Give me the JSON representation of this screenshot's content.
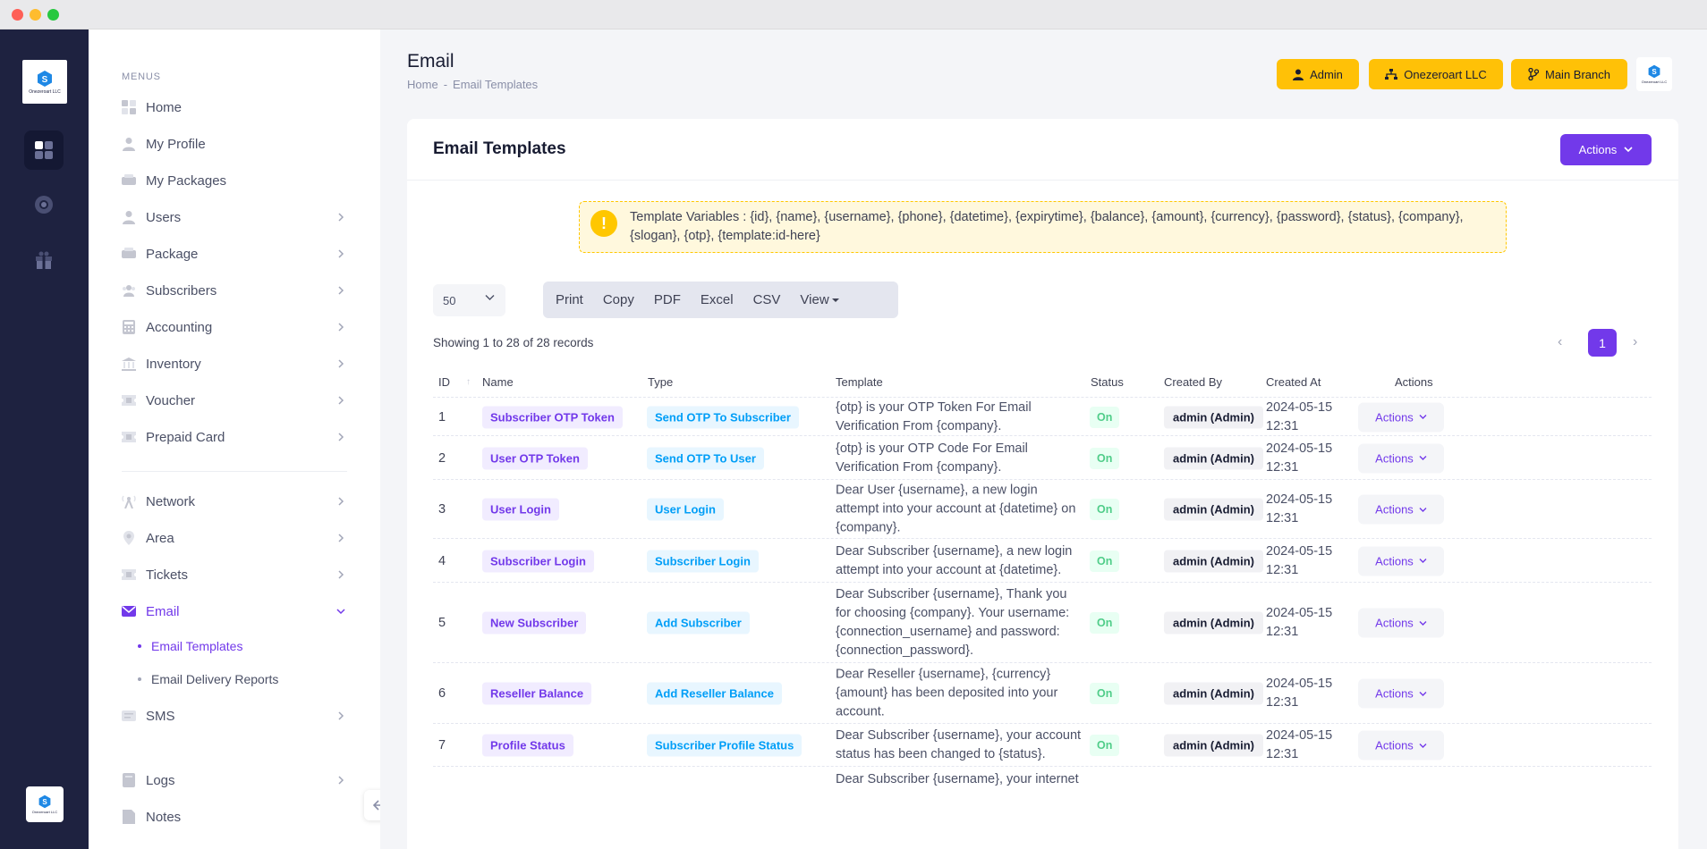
{
  "rail": {
    "logo_caption": "Onezeroart LLC",
    "bottom_logo_caption": "Onezeroart LLC"
  },
  "sidebar": {
    "menus_label": "MENUS",
    "items": [
      {
        "label": "Home",
        "icon": "home-grid-icon"
      },
      {
        "label": "My Profile",
        "icon": "user-icon"
      },
      {
        "label": "My Packages",
        "icon": "packages-icon"
      },
      {
        "label": "Users",
        "icon": "user-icon"
      },
      {
        "label": "Package",
        "icon": "packages-icon"
      },
      {
        "label": "Subscribers",
        "icon": "users-group-icon"
      },
      {
        "label": "Accounting",
        "icon": "calculator-icon"
      },
      {
        "label": "Inventory",
        "icon": "bank-icon"
      },
      {
        "label": "Voucher",
        "icon": "ticket-icon"
      },
      {
        "label": "Prepaid Card",
        "icon": "ticket-icon"
      },
      {
        "label": "Network",
        "icon": "antenna-icon"
      },
      {
        "label": "Area",
        "icon": "map-pin-icon"
      },
      {
        "label": "Tickets",
        "icon": "ticket-icon"
      },
      {
        "label": "Email",
        "icon": "envelope-icon"
      },
      {
        "label": "SMS",
        "icon": "message-icon"
      },
      {
        "label": "Logs",
        "icon": "book-icon"
      },
      {
        "label": "Notes",
        "icon": "note-icon"
      }
    ],
    "email_sub": [
      {
        "label": "Email Templates"
      },
      {
        "label": "Email Delivery Reports"
      }
    ]
  },
  "header": {
    "title": "Email",
    "breadcrumb": [
      "Home",
      "-",
      "Email Templates"
    ],
    "buttons": {
      "admin": "Admin",
      "company": "Onezeroart LLC",
      "branch": "Main Branch"
    },
    "logo_caption": "Onezeroart LLC"
  },
  "card": {
    "title": "Email Templates",
    "actions_label": "Actions",
    "alert_text": "Template Variables : {id}, {name}, {username}, {phone}, {datetime}, {expirytime}, {balance}, {amount}, {currency}, {password}, {status}, {company}, {slogan}, {otp}, {template:id-here}",
    "page_size": "50",
    "toolbar": [
      "Print",
      "Copy",
      "PDF",
      "Excel",
      "CSV",
      "View"
    ],
    "showing_text": "Showing 1 to 28 of 28 records",
    "pager": {
      "current": "1",
      "prev": "‹",
      "next": "›"
    }
  },
  "table": {
    "columns": [
      "ID",
      "Name",
      "Type",
      "Template",
      "Status",
      "Created By",
      "Created At",
      "Actions"
    ],
    "rows": [
      {
        "id": "1",
        "name": "Subscriber OTP Token",
        "type": "Send OTP To Subscriber",
        "template": "{otp} is your OTP Token For Email Verification From {company}.",
        "status": "On",
        "created_by": "admin (Admin)",
        "created_at": "2024-05-15 12:31",
        "actions": "Actions"
      },
      {
        "id": "2",
        "name": "User OTP Token",
        "type": "Send OTP To User",
        "template": "{otp} is your OTP Code For Email Verification From {company}.",
        "status": "On",
        "created_by": "admin (Admin)",
        "created_at": "2024-05-15 12:31",
        "actions": "Actions"
      },
      {
        "id": "3",
        "name": "User Login",
        "type": "User Login",
        "template": "Dear User {username}, a new login attempt into your account at {datetime} on {company}.",
        "status": "On",
        "created_by": "admin (Admin)",
        "created_at": "2024-05-15 12:31",
        "actions": "Actions"
      },
      {
        "id": "4",
        "name": "Subscriber Login",
        "type": "Subscriber Login",
        "template": "Dear Subscriber {username}, a new login attempt into your account at {datetime}.",
        "status": "On",
        "created_by": "admin (Admin)",
        "created_at": "2024-05-15 12:31",
        "actions": "Actions"
      },
      {
        "id": "5",
        "name": "New Subscriber",
        "type": "Add Subscriber",
        "template": "Dear Subscriber {username}, Thank you for choosing {company}. Your username: {connection_username} and password: {connection_password}.",
        "status": "On",
        "created_by": "admin (Admin)",
        "created_at": "2024-05-15 12:31",
        "actions": "Actions"
      },
      {
        "id": "6",
        "name": "Reseller Balance",
        "type": "Add Reseller Balance",
        "template": "Dear Reseller {username}, {currency} {amount} has been deposited into your account.",
        "status": "On",
        "created_by": "admin (Admin)",
        "created_at": "2024-05-15 12:31",
        "actions": "Actions"
      },
      {
        "id": "7",
        "name": "Profile Status",
        "type": "Subscriber Profile Status",
        "template": "Dear Subscriber {username}, your account status has been changed to {status}.",
        "status": "On",
        "created_by": "admin (Admin)",
        "created_at": "2024-05-15 12:31",
        "actions": "Actions"
      }
    ],
    "partial_row_text": "Dear Subscriber {username}, your internet"
  },
  "colors": {
    "accent": "#7239ea",
    "warning": "#ffc107",
    "rail_bg": "#1e2240",
    "success": "#50cd89",
    "info": "#009ef7"
  }
}
